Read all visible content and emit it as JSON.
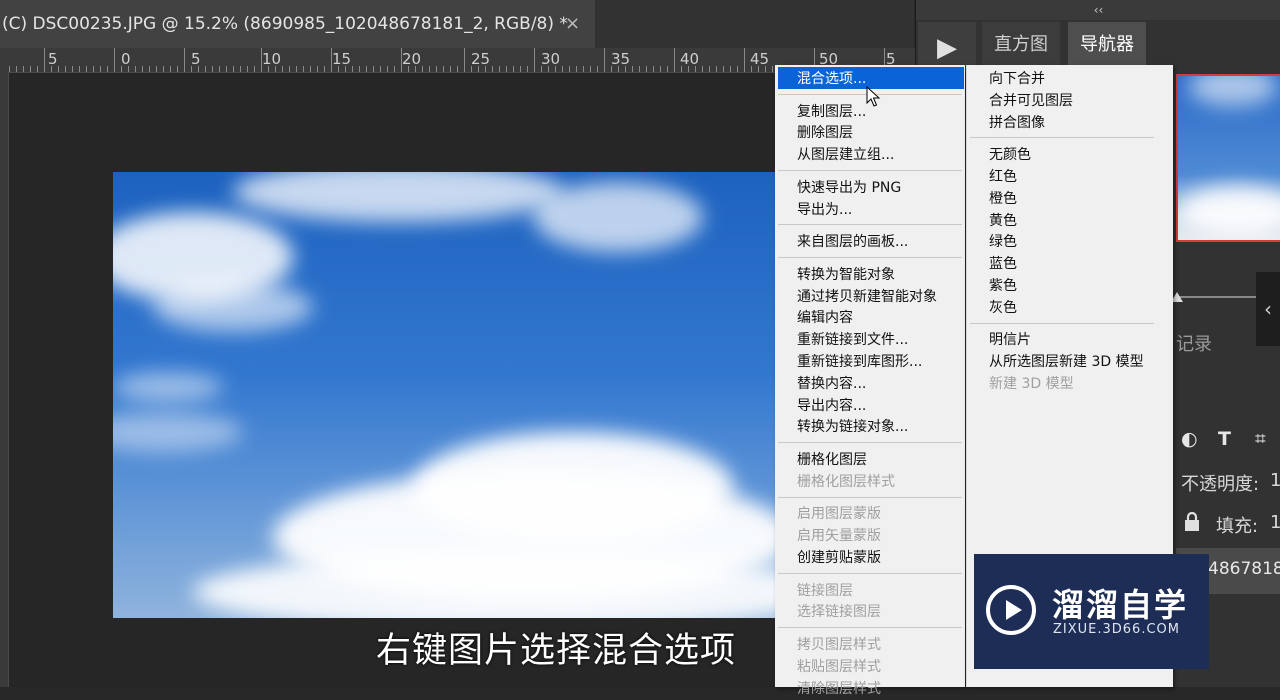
{
  "document": {
    "tab_title": "(C) DSC00235.JPG @ 15.2% (8690985_102048678181_2, RGB/8) *",
    "close_glyph": "×"
  },
  "ruler": {
    "labels": [
      "5",
      "0",
      "5",
      "10",
      "15",
      "20",
      "25",
      "30",
      "35",
      "40",
      "45",
      "50",
      "5"
    ]
  },
  "subtitle": "右键图片选择混合选项",
  "panels": {
    "collapse_glyph": "‹‹",
    "play_glyph": "▶",
    "tabs": [
      {
        "label": "直方图",
        "active": false
      },
      {
        "label": "导航器",
        "active": true
      }
    ],
    "history_partial": "记录",
    "side_arrow_glyph": "‹",
    "tools": {
      "circle_half": "◐",
      "text_tool": "T",
      "transform": "⌗"
    },
    "opacity_label": "不透明度:",
    "opacity_value": "1",
    "lock_icon": "lock-icon",
    "fill_label": "填充:",
    "fill_value": "1",
    "layer_name_partial": "48678181"
  },
  "context_menu": {
    "left_column": [
      {
        "label": "混合选项...",
        "highlighted": true,
        "disabled": false
      },
      {
        "separator": true
      },
      {
        "label": "复制图层...",
        "disabled": false
      },
      {
        "label": "删除图层",
        "disabled": false
      },
      {
        "label": "从图层建立组...",
        "disabled": false
      },
      {
        "separator": true
      },
      {
        "label": "快速导出为 PNG",
        "disabled": false
      },
      {
        "label": "导出为...",
        "disabled": false
      },
      {
        "separator": true
      },
      {
        "label": "来自图层的画板...",
        "disabled": false
      },
      {
        "separator": true
      },
      {
        "label": "转换为智能对象",
        "disabled": false
      },
      {
        "label": "通过拷贝新建智能对象",
        "disabled": false
      },
      {
        "label": "编辑内容",
        "disabled": false
      },
      {
        "label": "重新链接到文件...",
        "disabled": false
      },
      {
        "label": "重新链接到库图形...",
        "disabled": false
      },
      {
        "label": "替换内容...",
        "disabled": false
      },
      {
        "label": "导出内容...",
        "disabled": false
      },
      {
        "label": "转换为链接对象...",
        "disabled": false
      },
      {
        "separator": true
      },
      {
        "label": "栅格化图层",
        "disabled": false
      },
      {
        "label": "栅格化图层样式",
        "disabled": true
      },
      {
        "separator": true
      },
      {
        "label": "启用图层蒙版",
        "disabled": true
      },
      {
        "label": "启用矢量蒙版",
        "disabled": true
      },
      {
        "label": "创建剪贴蒙版",
        "disabled": false
      },
      {
        "separator": true
      },
      {
        "label": "链接图层",
        "disabled": true
      },
      {
        "label": "选择链接图层",
        "disabled": true
      },
      {
        "separator": true
      },
      {
        "label": "拷贝图层样式",
        "disabled": true
      },
      {
        "label": "粘贴图层样式",
        "disabled": true
      },
      {
        "label": "清除图层样式",
        "disabled": true
      }
    ],
    "right_column": [
      {
        "label": "向下合并",
        "disabled": false
      },
      {
        "label": "合并可见图层",
        "disabled": false
      },
      {
        "label": "拼合图像",
        "disabled": false
      },
      {
        "separator": true
      },
      {
        "label": "无颜色",
        "disabled": false
      },
      {
        "label": "红色",
        "disabled": false
      },
      {
        "label": "橙色",
        "disabled": false
      },
      {
        "label": "黄色",
        "disabled": false
      },
      {
        "label": "绿色",
        "disabled": false
      },
      {
        "label": "蓝色",
        "disabled": false
      },
      {
        "label": "紫色",
        "disabled": false
      },
      {
        "label": "灰色",
        "disabled": false
      },
      {
        "separator": true
      },
      {
        "label": "明信片",
        "disabled": false
      },
      {
        "label": "从所选图层新建 3D 模型",
        "disabled": false
      },
      {
        "label": "新建 3D 模型",
        "disabled": true
      }
    ]
  },
  "watermark": {
    "title": "溜溜自学",
    "url": "ZIXUE.3D66.COM"
  },
  "colors": {
    "menu_highlight": "#0a64d8",
    "navigator_frame": "#d83b3b",
    "watermark_bg": "#1e2d55"
  }
}
